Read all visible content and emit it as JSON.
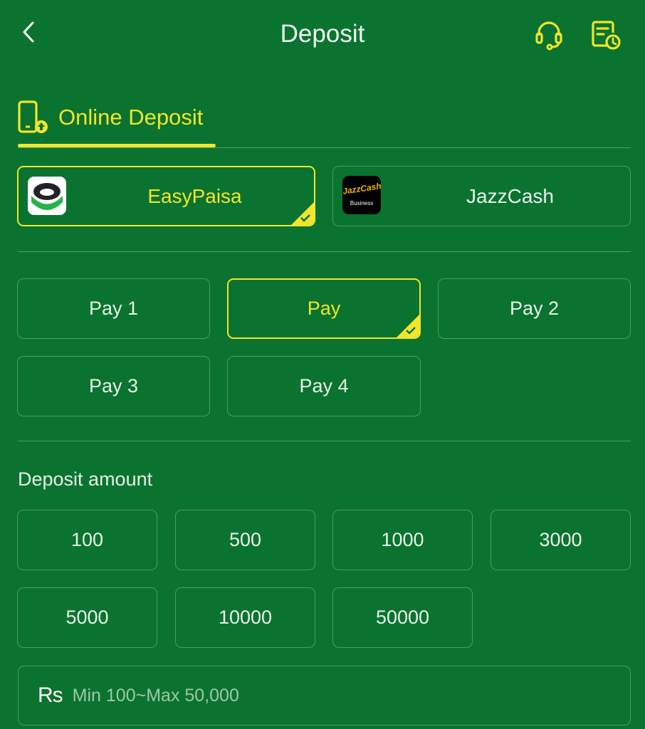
{
  "header": {
    "title": "Deposit"
  },
  "tab": {
    "label": "Online Deposit"
  },
  "methods": [
    {
      "label": "EasyPaisa",
      "selected": true
    },
    {
      "label": "JazzCash",
      "selected": false
    }
  ],
  "jazzcash_logo": {
    "line1": "JazzCash",
    "line2": "Business"
  },
  "channels": [
    {
      "label": "Pay 1",
      "selected": false
    },
    {
      "label": "Pay",
      "selected": true
    },
    {
      "label": "Pay 2",
      "selected": false
    },
    {
      "label": "Pay 3",
      "selected": false
    },
    {
      "label": "Pay 4",
      "selected": false
    }
  ],
  "amount_section": {
    "label": "Deposit amount"
  },
  "amounts": [
    "100",
    "500",
    "1000",
    "3000",
    "5000",
    "10000",
    "50000"
  ],
  "amount_input": {
    "currency": "Rs",
    "placeholder": "Min 100~Max 50,000"
  },
  "colors": {
    "background": "#0b7330",
    "accent": "#f2e52b",
    "border": "#4d9a63"
  }
}
